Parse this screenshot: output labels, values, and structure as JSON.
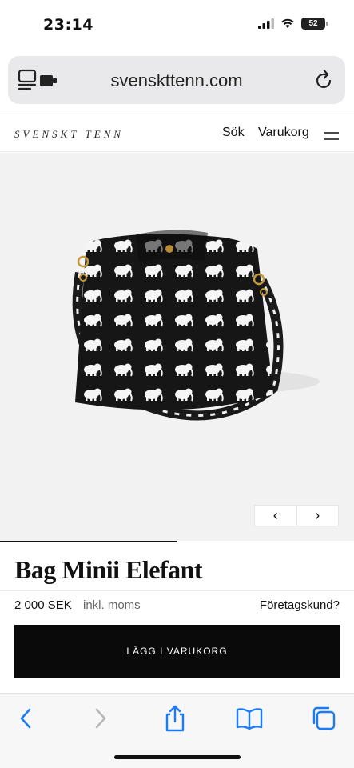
{
  "status_bar": {
    "time": "23:14",
    "battery_level": "52",
    "icons": [
      "signal-icon",
      "wifi-icon",
      "battery-icon"
    ]
  },
  "browser": {
    "url": "svenskttenn.com",
    "left_icon": "page-settings-icon",
    "right_icon": "reload-icon"
  },
  "site_header": {
    "logo": "Svenskt Tenn",
    "nav": {
      "search_label": "Sök",
      "cart_label": "Varukorg",
      "menu_icon": "hamburger-icon"
    }
  },
  "carousel": {
    "prev_symbol": "‹",
    "next_symbol": "›",
    "progress": 0.5
  },
  "product": {
    "title": "Bag Minii Elefant",
    "price": "2 000 SEK",
    "vat_note": "inkl. moms",
    "business_link": "Företagskund?",
    "add_to_cart_label": "LÄGG I VARUKORG"
  },
  "toolbar": {
    "icons": [
      "back-icon",
      "forward-icon",
      "share-icon",
      "bookmarks-icon",
      "tabs-icon"
    ]
  },
  "colors": {
    "accent": "#0a0a0a",
    "url_bar_bg": "#e9e9eb",
    "image_bg": "#f2f2f2",
    "ios_blue": "#1a7cf5"
  }
}
